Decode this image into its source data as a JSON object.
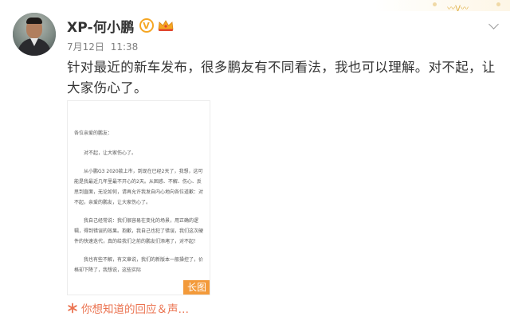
{
  "user": {
    "name": "XP-何小鹏",
    "verified_badge_icon": "verified-v-icon",
    "vip_badge_icon": "crown-icon",
    "verified_letter": "V"
  },
  "post": {
    "date": "7月12日",
    "time": "11:38",
    "text": "针对最近的新车发布，很多鹏友有不同看法，我也可以理解。对不起，让大家伤心了。",
    "image": {
      "badge_label": "长图",
      "letter": {
        "salutation": "各位亲爱的鹏友：",
        "paragraphs": [
          "对不起，让大家伤心了。",
          "从小鹏G3 2020款上市，到现在已经2天了，我想，这可能是我最近几年里最不开心的2天。从困惑、不解、伤心、反思到直面，无论如何，请再允许我发自内心地向各位道歉：对不起，亲爱的鹏友，让大家伤心了。",
          "我自己经常说：我们很容易在变化的场景，用正确的逻辑，得到错误的效果。抱歉，我自己也犯了错误，我们这次硬件的快速迭代，真的给我们之前的鹏友们添堵了，对不起！",
          "我也有些不解，有文章说，我们的新版本一般操控了，价格却下降了，我想说，这些实际"
        ]
      }
    },
    "footer_link": "你想知道的回应＆声…",
    "footer_icon": "asterisk-icon"
  },
  "colors": {
    "accent": "#eb7350",
    "badge": "#f39a3a",
    "vip": "#f5a623",
    "text": "#333333",
    "meta": "#808080"
  }
}
